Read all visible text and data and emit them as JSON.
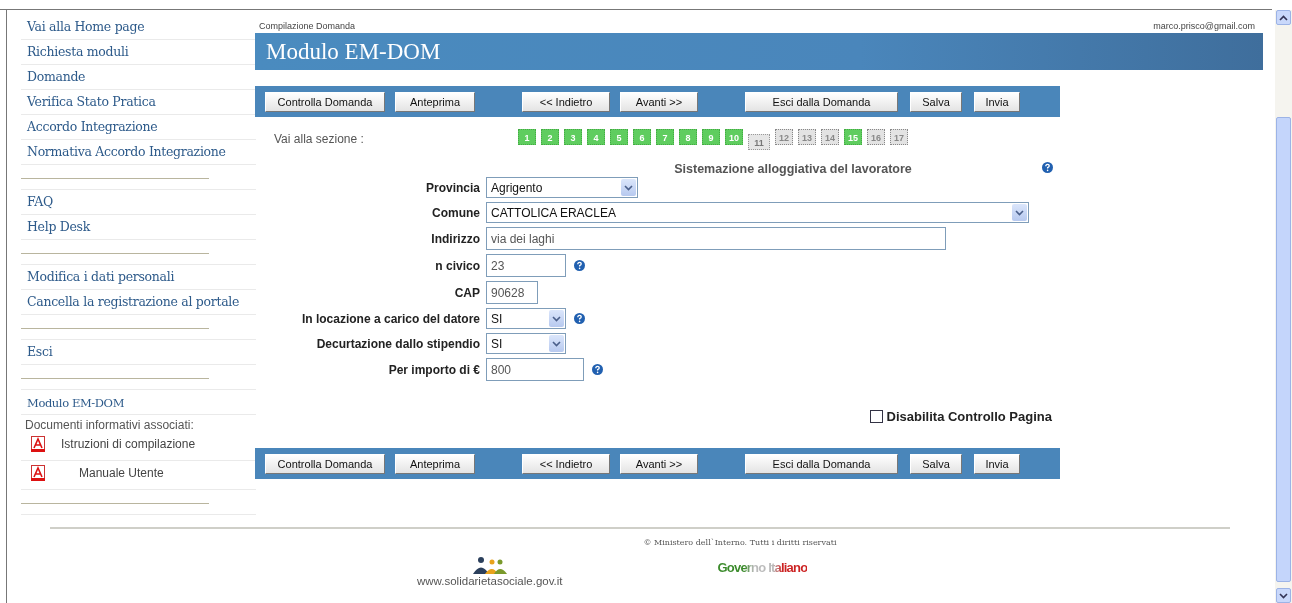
{
  "sidebar": {
    "groups": [
      [
        "Vai alla Home page",
        "Richiesta moduli",
        "Domande",
        "Verifica Stato Pratica",
        "Accordo Integrazione",
        "Normativa Accordo Integrazione"
      ],
      [
        "FAQ",
        "Help Desk"
      ],
      [
        "Modifica i dati personali",
        "Cancella la registrazione al portale"
      ],
      [
        "Esci"
      ]
    ],
    "module": {
      "title": "Modulo EM-DOM",
      "caption": "Documenti informativi associati:",
      "documents": [
        "Istruzioni di compilazione",
        "Manuale Utente"
      ]
    }
  },
  "breadcrumb": "Compilazione Domanda",
  "user": "marco.prisco@gmail.com",
  "title": "Modulo EM-DOM",
  "toolbar_top": [
    [
      "Controlla Domanda",
      "Anteprima"
    ],
    [
      "<< Indietro",
      "Avanti >>"
    ],
    [
      "Esci dalla Domanda",
      "Salva",
      "Invia"
    ]
  ],
  "sections": {
    "label": "Vai alla sezione :",
    "items": [
      {
        "label": "1",
        "complete": true,
        "selected": false
      },
      {
        "label": "2",
        "complete": true,
        "selected": false
      },
      {
        "label": "3",
        "complete": true,
        "selected": false
      },
      {
        "label": "4",
        "complete": true,
        "selected": false
      },
      {
        "label": "5",
        "complete": true,
        "selected": false
      },
      {
        "label": "6",
        "complete": true,
        "selected": false
      },
      {
        "label": "7",
        "complete": true,
        "selected": false
      },
      {
        "label": "8",
        "complete": true,
        "selected": false
      },
      {
        "label": "9",
        "complete": true,
        "selected": false
      },
      {
        "label": "10",
        "complete": true,
        "selected": false
      },
      {
        "label": "11",
        "complete": false,
        "selected": true
      },
      {
        "label": "12",
        "complete": false,
        "selected": false
      },
      {
        "label": "13",
        "complete": false,
        "selected": false
      },
      {
        "label": "14",
        "complete": false,
        "selected": false
      },
      {
        "label": "15",
        "complete": true,
        "selected": false
      },
      {
        "label": "16",
        "complete": false,
        "selected": false
      },
      {
        "label": "17",
        "complete": false,
        "selected": false
      }
    ]
  },
  "form": {
    "title": "Sistemazione alloggiativa del lavoratore",
    "help": true,
    "fields": [
      {
        "label": "Provincia",
        "kind": "select",
        "value": "Agrigento",
        "help": false
      },
      {
        "label": "Comune",
        "kind": "select",
        "value": "CATTOLICA ERACLEA",
        "help": false
      },
      {
        "label": "Indirizzo",
        "kind": "text",
        "value": "via dei laghi",
        "help": false
      },
      {
        "label": "n civico",
        "kind": "text",
        "value": "23",
        "help": true
      },
      {
        "label": "CAP",
        "kind": "text",
        "value": "90628",
        "help": false
      },
      {
        "label": "In locazione a carico del datore",
        "kind": "select",
        "value": "SI",
        "help": true
      },
      {
        "label": "Decurtazione dallo stipendio",
        "kind": "select",
        "value": "SI",
        "help": false
      },
      {
        "label": "Per importo di €",
        "kind": "text",
        "value": "800",
        "help": true
      }
    ],
    "disable_check": {
      "label": "Disabilita Controllo Pagina",
      "checked": false
    }
  },
  "toolbar_bottom": [
    [
      "Controlla Domanda",
      "Anteprima"
    ],
    [
      "<< Indietro",
      "Avanti >>"
    ],
    [
      "Esci dalla Domanda",
      "Salva",
      "Invia"
    ]
  ],
  "footer": {
    "copyright": "© Ministero dell`Interno. Tutti i diritti riservati",
    "site": "www.solidarietasociale.gov.it",
    "logo": "Governo Italiano"
  }
}
